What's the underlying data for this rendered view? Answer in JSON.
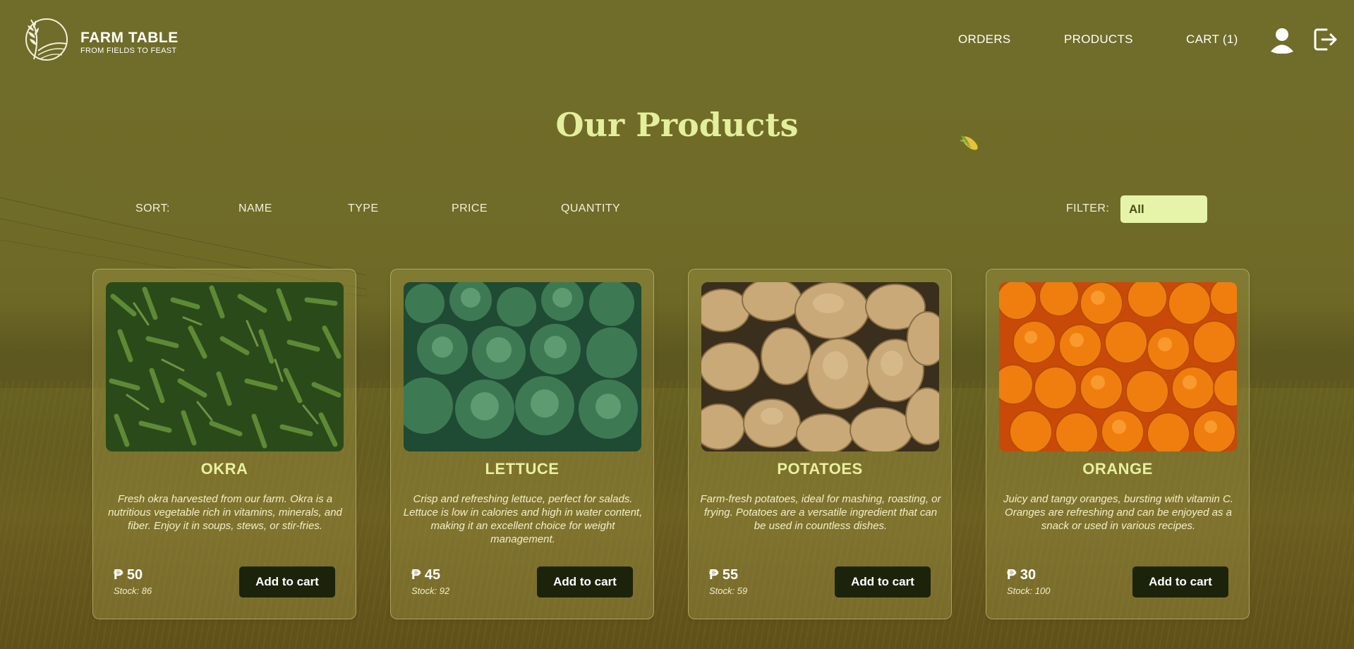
{
  "brand": {
    "title": "FARM TABLE",
    "tagline": "FROM FIELDS TO FEAST"
  },
  "nav": {
    "orders": "ORDERS",
    "products": "PRODUCTS",
    "cart": "CART (1)",
    "icons": [
      "user-icon",
      "logout-icon"
    ]
  },
  "page": {
    "title": "Our Products"
  },
  "sort": {
    "label": "SORT:",
    "options": [
      "NAME",
      "TYPE",
      "PRICE",
      "QUANTITY"
    ]
  },
  "filter": {
    "label": "FILTER:",
    "selected": "All"
  },
  "products": [
    {
      "name": "OKRA",
      "description": "Fresh okra harvested from our farm. Okra is a nutritious vegetable rich in vitamins, minerals, and fiber. Enjoy it in soups, stews, or stir-fries.",
      "price": "₱ 50",
      "stock": "Stock: 86",
      "button": "Add to cart"
    },
    {
      "name": "LETTUCE",
      "description": "Crisp and refreshing lettuce, perfect for salads. Lettuce is low in calories and high in water content, making it an excellent choice for weight management.",
      "price": "₱ 45",
      "stock": "Stock: 92",
      "button": "Add to cart"
    },
    {
      "name": "POTATOES",
      "description": "Farm-fresh potatoes, ideal for mashing, roasting, or frying. Potatoes are a versatile ingredient that can be used in countless dishes.",
      "price": "₱ 55",
      "stock": "Stock: 59",
      "button": "Add to cart"
    },
    {
      "name": "ORANGE",
      "description": "Juicy and tangy oranges, bursting with vitamin C. Oranges are refreshing and can be enjoyed as a snack or used in various recipes.",
      "price": "₱ 30",
      "stock": "Stock: 100",
      "button": "Add to cart"
    }
  ],
  "colors": {
    "background": "#6d6b26",
    "title": "#e3ef9c",
    "button": "#1c230b",
    "filter": "#e6f4a9"
  }
}
